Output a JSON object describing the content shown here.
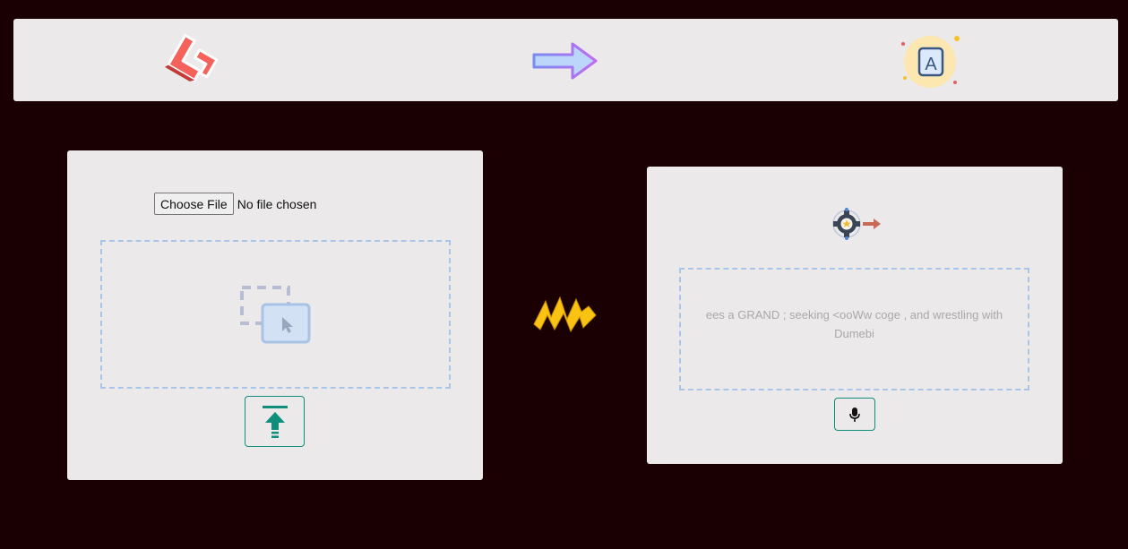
{
  "header": {
    "left_icon": "laravel-logo-icon",
    "center_icon": "arrow-right-icon",
    "right_icon": "translate-a-icon"
  },
  "upload_panel": {
    "choose_file_label": "Choose File",
    "file_status": "No file chosen",
    "dropzone_icon": "select-area-cursor-icon",
    "upload_icon": "upload-arrow-icon"
  },
  "divider_icon": "lightning-bolt-icon",
  "output_panel": {
    "status_icon": "gear-arrow-icon",
    "transcript_text": "ees a GRAND ; seeking <ooWw coge , and wrestling with Dumebi",
    "mic_icon": "microphone-icon"
  },
  "colors": {
    "background": "#1a0003",
    "panel": "#ebe9ea",
    "accent_teal": "#0f8e7c",
    "dashed_border": "#a9c6ea"
  }
}
